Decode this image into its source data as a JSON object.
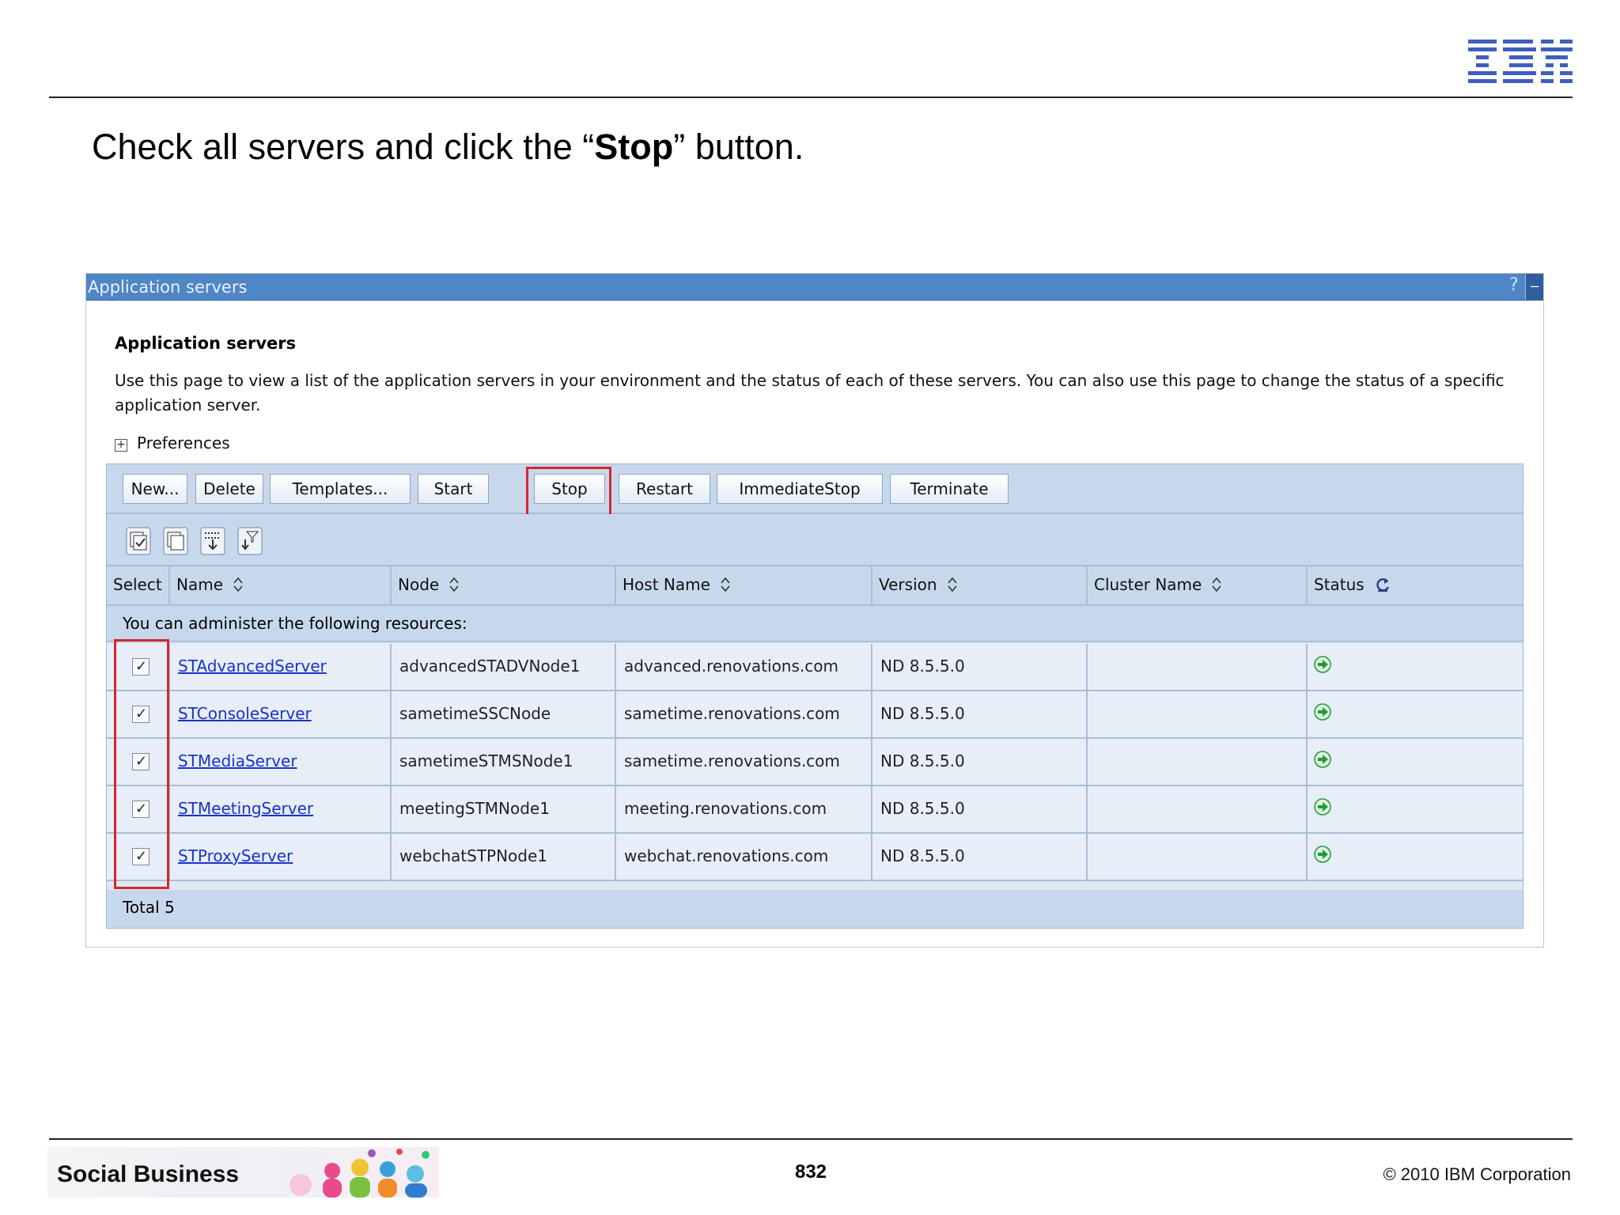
{
  "slide": {
    "title_prefix": "Check all servers and click the “",
    "title_bold": "Stop",
    "title_suffix": "” button.",
    "logo_text": "IBM",
    "footer_brand": "Social Business",
    "page_number": "832",
    "copyright": "© 2010 IBM Corporation"
  },
  "panel": {
    "header_title": "Application servers",
    "help_label": "?",
    "minimize_label": "–",
    "heading": "Application servers",
    "description": "Use this page to view a list of the application servers in your environment and the status of each of these servers. You can also use this page to change the status of a specific application server.",
    "preferences_label": "Preferences",
    "preferences_toggle": "+"
  },
  "toolbar": {
    "buttons": [
      "New...",
      "Delete",
      "Templates...",
      "Start",
      "Stop",
      "Restart",
      "ImmediateStop",
      "Terminate"
    ]
  },
  "table": {
    "columns": [
      "Select",
      "Name",
      "Node",
      "Host Name",
      "Version",
      "Cluster Name",
      "Status"
    ],
    "message": "You can administer the following resources:",
    "rows": [
      {
        "name": "STAdvancedServer",
        "node": "advancedSTADVNode1",
        "host": "advanced.renovations.com",
        "version": "ND 8.5.5.0",
        "cluster": "",
        "checked": true,
        "status": "started"
      },
      {
        "name": "STConsoleServer",
        "node": "sametimeSSCNode",
        "host": "sametime.renovations.com",
        "version": "ND 8.5.5.0",
        "cluster": "",
        "checked": true,
        "status": "started"
      },
      {
        "name": "STMediaServer",
        "node": "sametimeSTMSNode1",
        "host": "sametime.renovations.com",
        "version": "ND 8.5.5.0",
        "cluster": "",
        "checked": true,
        "status": "started"
      },
      {
        "name": "STMeetingServer",
        "node": "meetingSTMNode1",
        "host": "meeting.renovations.com",
        "version": "ND 8.5.5.0",
        "cluster": "",
        "checked": true,
        "status": "started"
      },
      {
        "name": "STProxyServer",
        "node": "webchatSTPNode1",
        "host": "webchat.renovations.com",
        "version": "ND 8.5.5.0",
        "cluster": "",
        "checked": true,
        "status": "started"
      }
    ],
    "total_label": "Total 5"
  },
  "colors": {
    "header_blue": "#4f86c6",
    "highlight_red": "#d6262c",
    "link_blue": "#1a33cc",
    "status_green": "#1f9a3a"
  },
  "icons": [
    "select-all-icon",
    "deselect-all-icon",
    "expand-filter-icon",
    "clear-filter-icon",
    "status-refresh-icon",
    "status-started-icon"
  ]
}
